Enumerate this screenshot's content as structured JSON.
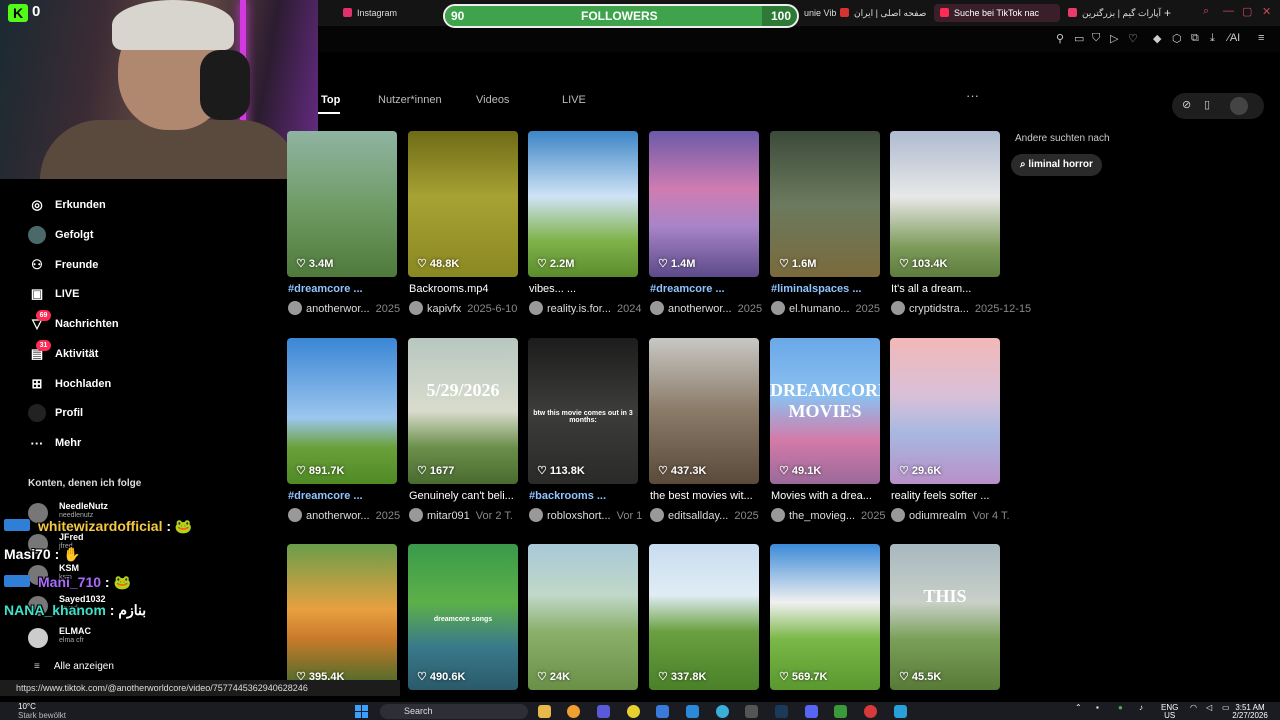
{
  "browser": {
    "tabs": [
      {
        "label": "Instagram",
        "color": "#e1306c"
      },
      {
        "label": "unie Vibe",
        "color": "#777777"
      },
      {
        "label": "صفحه اصلی | ایران",
        "color": "#d33333"
      },
      {
        "label": "Suche bei TikTok nac",
        "color": "#fe2c55"
      },
      {
        "label": "آپارات گیم | بزرگترین",
        "color": "#ea3a6b"
      }
    ],
    "new_tab": "+"
  },
  "followers_goal": {
    "current": "90",
    "label": "FOLLOWERS",
    "target": "100",
    "progress": 0.9
  },
  "kick": {
    "logo": "K",
    "viewers": "0"
  },
  "search_tabs": [
    "Top",
    "Nutzer*innen",
    "Videos",
    "LIVE"
  ],
  "sidebar": {
    "items": [
      {
        "label": "Erkunden",
        "icon": "compass-icon"
      },
      {
        "label": "Gefolgt",
        "icon": "avatar-icon"
      },
      {
        "label": "Freunde",
        "icon": "friends-icon"
      },
      {
        "label": "LIVE",
        "icon": "live-tv-icon"
      },
      {
        "label": "Nachrichten",
        "icon": "inbox-icon",
        "badge": "69"
      },
      {
        "label": "Aktivität",
        "icon": "activity-icon",
        "badge": "31"
      },
      {
        "label": "Hochladen",
        "icon": "upload-icon"
      },
      {
        "label": "Profil",
        "icon": "profile-icon"
      },
      {
        "label": "Mehr",
        "icon": "more-icon"
      }
    ],
    "following_heading": "Konten, denen ich folge",
    "accounts": [
      {
        "name": "NeedleNutz",
        "handle": "needlenutz"
      },
      {
        "name": "JFred",
        "handle": "jfred"
      },
      {
        "name": "KSM",
        "handle": "ksm"
      },
      {
        "name": "Sayed1032",
        "handle": "sayed"
      },
      {
        "name": "ELMAC",
        "handle": "elma cfr"
      }
    ],
    "show_all": "Alle anzeigen"
  },
  "chat": [
    {
      "user": "whitewizardofficial",
      "sep": " :",
      "color": "#f5c842"
    },
    {
      "user": "Masi70",
      "sep": " :",
      "color": "#ffffff"
    },
    {
      "user": "Mani_710",
      "sep": " :",
      "color": "#a96bff"
    },
    {
      "user": "NANA_khanom",
      "sep": " : بنازم",
      "color": "#3fe0c8"
    }
  ],
  "videos": [
    {
      "likes": "3.4M",
      "caption": "#dreamcore ...",
      "tag": true,
      "author": "anotherwor...",
      "date": "2025",
      "bg": "linear-gradient(180deg,#8fb4a2 0%,#6d9a62 55%,#4f7a3c 100%)"
    },
    {
      "likes": "48.8K",
      "caption": "Backrooms.mp4",
      "tag": false,
      "author": "kapivfx",
      "date": "2025-6-10",
      "bg": "linear-gradient(180deg,#6e6b18 0%,#a7a233 45%,#8a8822 100%)"
    },
    {
      "likes": "2.2M",
      "caption": "vibes... ...",
      "tag": false,
      "author": "reality.is.for...",
      "date": "2024",
      "bg": "linear-gradient(180deg,#3d85c6 0%,#cfe3f5 45%,#7fb34a 75%,#5b8c2c 100%)"
    },
    {
      "likes": "1.4M",
      "caption": "#dreamcore ...",
      "tag": true,
      "author": "anotherwor...",
      "date": "2025",
      "bg": "linear-gradient(180deg,#6c5aa8 0%,#d07cb2 40%,#a885c8 65%,#5d4a8a 100%)"
    },
    {
      "likes": "1.6M",
      "caption": "#liminalspaces ...",
      "tag": true,
      "author": "el.humano...",
      "date": "2025",
      "bg": "linear-gradient(180deg,#3c4a3a 0%,#6b7a5e 50%,#7a6a3c 100%)"
    },
    {
      "likes": "103.4K",
      "caption": "It's all a dream...",
      "tag": false,
      "author": "cryptidstra...",
      "date": "2025-12-15",
      "bg": "linear-gradient(180deg,#aebbd0 0%,#e8e8e8 45%,#7c9a58 80%,#5f7d3d 100%)"
    },
    {
      "likes": "891.7K",
      "caption": "#dreamcore ...",
      "tag": true,
      "author": "anotherwor...",
      "date": "2025",
      "bg": "linear-gradient(180deg,#3a86d6 0%,#9cc6ee 55%,#6aa03a 75%,#4f8a24 100%)"
    },
    {
      "likes": "1677",
      "caption": "Genuinely can't beli...",
      "tag": false,
      "author": "mitar091",
      "date": "Vor 2 T.",
      "bg": "linear-gradient(180deg,#b7c7c0 0%,#d9dccd 50%,#6b8f4a 75%,#4a6b30 100%)",
      "overlay": "5/29/2026"
    },
    {
      "likes": "113.8K",
      "caption": "#backrooms ...",
      "tag": true,
      "author": "robloxshort...",
      "date": "Vor 1",
      "bg": "linear-gradient(180deg,#1c1c1c 0%,#3c3c3a 50%,#2a2a28 100%)",
      "overlay": "btw this movie comes out in 3 months:"
    },
    {
      "likes": "437.3K",
      "caption": "the best movies wit...",
      "tag": false,
      "author": "editsallday...",
      "date": "2025",
      "bg": "linear-gradient(180deg,#c8c8c4 0%,#8a7a68 50%,#5a4a3a 100%)"
    },
    {
      "likes": "49.1K",
      "caption": "Movies with a drea...",
      "tag": false,
      "author": "the_movieg...",
      "date": "2025",
      "bg": "linear-gradient(180deg,#6aa8e8 0%,#8cc0f0 40%,#d47aa8 70%,#9a6a9a 100%)",
      "overlay": "DREAMCORE MOVIES"
    },
    {
      "likes": "29.6K",
      "caption": "reality feels softer ...",
      "tag": false,
      "author": "odiumrealm",
      "date": "Vor 4 T.",
      "bg": "linear-gradient(180deg,#f2b8b8 0%,#d8c0d8 40%,#a8b8e0 65%,#b890c8 100%)"
    },
    {
      "likes": "395.4K",
      "caption": "",
      "tag": false,
      "author": "",
      "date": "",
      "bg": "linear-gradient(180deg,#6a9e4a 0%,#e8a040 45%,#c87a2a 65%,#3d6a2a 100%)"
    },
    {
      "likes": "490.6K",
      "caption": "",
      "tag": false,
      "author": "",
      "date": "",
      "bg": "linear-gradient(180deg,#3a9a4a 0%,#5cb048 40%,#3a7a8a 70%,#2a5a6a 100%)",
      "overlay": "dreamcore songs"
    },
    {
      "likes": "24K",
      "caption": "",
      "tag": false,
      "author": "",
      "date": "",
      "bg": "linear-gradient(180deg,#a8c8d8 0%,#c0d8c8 35%,#8ab06a 60%,#6a9048 100%)"
    },
    {
      "likes": "337.8K",
      "caption": "",
      "tag": false,
      "author": "",
      "date": "",
      "bg": "linear-gradient(180deg,#c8dcf0 0%,#e0ecf4 35%,#6aa040 60%,#4a8028 100%)"
    },
    {
      "likes": "569.7K",
      "caption": "",
      "tag": false,
      "author": "",
      "date": "",
      "bg": "linear-gradient(180deg,#3c8ad8 0%,#f0f0f0 40%,#7ab848 65%,#5a9830 100%)"
    },
    {
      "likes": "45.5K",
      "caption": "",
      "tag": false,
      "author": "",
      "date": "",
      "bg": "linear-gradient(180deg,#a8b8c0 0%,#c8d0c8 40%,#7aa058 65%,#587a38 100%)",
      "overlay": "THIS"
    }
  ],
  "search_suggestions": {
    "heading": "Andere suchten nach",
    "chip": "liminal horror"
  },
  "status_url": "https://www.tiktok.com/@anotherworldcore/video/7577445362940628246",
  "taskbar": {
    "weather_temp": "10°C",
    "weather_desc": "Stark bewölkt",
    "search": "Search",
    "lang1": "ENG",
    "lang2": "US",
    "time": "3:51 AM",
    "date": "2/27/2026"
  }
}
